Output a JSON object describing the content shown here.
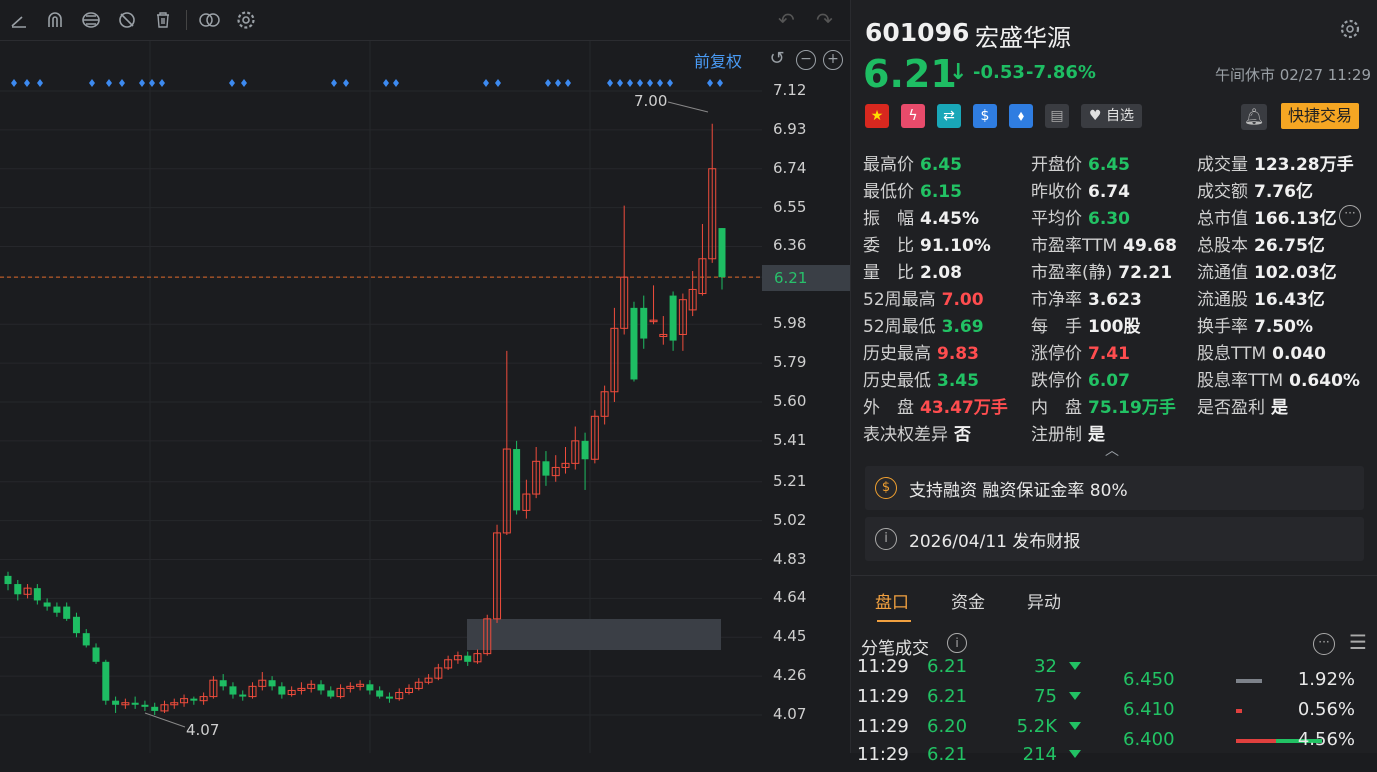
{
  "toolbar": {
    "icons": [
      "line-icon",
      "magnet-icon",
      "layers-icon",
      "hide-icon",
      "trash-icon",
      "compare-icon",
      "gear-icon"
    ],
    "fuquan_label": "前复权"
  },
  "chart_data": {
    "type": "candlestick",
    "y_ticks": [
      "7.12",
      "6.93",
      "6.74",
      "6.55",
      "6.36",
      "6.21",
      "5.98",
      "5.79",
      "5.60",
      "5.41",
      "5.21",
      "5.02",
      "4.83",
      "4.64",
      "4.45",
      "4.26",
      "4.07"
    ],
    "current_price": "6.21",
    "high_marker": "7.00",
    "low_marker": "4.07",
    "ylim": [
      4.02,
      7.16
    ],
    "candles": [
      [
        4.75,
        4.71,
        4.77,
        4.68
      ],
      [
        4.71,
        4.66,
        4.73,
        4.63
      ],
      [
        4.66,
        4.69,
        4.71,
        4.64
      ],
      [
        4.69,
        4.63,
        4.71,
        4.61
      ],
      [
        4.62,
        4.6,
        4.64,
        4.58
      ],
      [
        4.6,
        4.57,
        4.62,
        4.55
      ],
      [
        4.6,
        4.54,
        4.62,
        4.53
      ],
      [
        4.55,
        4.47,
        4.57,
        4.45
      ],
      [
        4.47,
        4.41,
        4.49,
        4.4
      ],
      [
        4.4,
        4.33,
        4.42,
        4.32
      ],
      [
        4.33,
        4.14,
        4.34,
        4.12
      ],
      [
        4.14,
        4.12,
        4.16,
        4.08
      ],
      [
        4.12,
        4.13,
        4.15,
        4.1
      ],
      [
        4.13,
        4.12,
        4.16,
        4.1
      ],
      [
        4.12,
        4.11,
        4.14,
        4.09
      ],
      [
        4.11,
        4.09,
        4.13,
        4.07
      ],
      [
        4.09,
        4.12,
        4.14,
        4.08
      ],
      [
        4.12,
        4.13,
        4.15,
        4.1
      ],
      [
        4.13,
        4.15,
        4.17,
        4.11
      ],
      [
        4.15,
        4.14,
        4.16,
        4.12
      ],
      [
        4.14,
        4.16,
        4.18,
        4.12
      ],
      [
        4.16,
        4.24,
        4.26,
        4.15
      ],
      [
        4.24,
        4.21,
        4.27,
        4.19
      ],
      [
        4.21,
        4.17,
        4.23,
        4.15
      ],
      [
        4.17,
        4.16,
        4.19,
        4.14
      ],
      [
        4.16,
        4.21,
        4.23,
        4.15
      ],
      [
        4.21,
        4.24,
        4.28,
        4.19
      ],
      [
        4.24,
        4.21,
        4.26,
        4.19
      ],
      [
        4.21,
        4.17,
        4.23,
        4.15
      ],
      [
        4.17,
        4.19,
        4.21,
        4.16
      ],
      [
        4.19,
        4.2,
        4.23,
        4.17
      ],
      [
        4.2,
        4.22,
        4.24,
        4.18
      ],
      [
        4.22,
        4.19,
        4.24,
        4.17
      ],
      [
        4.19,
        4.16,
        4.21,
        4.15
      ],
      [
        4.16,
        4.2,
        4.22,
        4.15
      ],
      [
        4.2,
        4.21,
        4.23,
        4.18
      ],
      [
        4.21,
        4.22,
        4.24,
        4.19
      ],
      [
        4.22,
        4.19,
        4.24,
        4.17
      ],
      [
        4.19,
        4.16,
        4.21,
        4.15
      ],
      [
        4.16,
        4.15,
        4.18,
        4.13
      ],
      [
        4.15,
        4.18,
        4.2,
        4.14
      ],
      [
        4.18,
        4.2,
        4.22,
        4.17
      ],
      [
        4.2,
        4.23,
        4.25,
        4.19
      ],
      [
        4.23,
        4.25,
        4.27,
        4.22
      ],
      [
        4.25,
        4.3,
        4.32,
        4.24
      ],
      [
        4.3,
        4.34,
        4.36,
        4.29
      ],
      [
        4.34,
        4.36,
        4.38,
        4.32
      ],
      [
        4.36,
        4.33,
        4.38,
        4.31
      ],
      [
        4.33,
        4.37,
        4.39,
        4.32
      ],
      [
        4.37,
        4.54,
        4.56,
        4.36
      ],
      [
        4.54,
        4.96,
        5.0,
        4.52
      ],
      [
        4.96,
        5.37,
        5.85,
        4.95
      ],
      [
        5.37,
        5.07,
        5.41,
        5.05
      ],
      [
        5.07,
        5.15,
        5.22,
        5.03
      ],
      [
        5.15,
        5.31,
        5.38,
        5.13
      ],
      [
        5.31,
        5.24,
        5.36,
        5.19
      ],
      [
        5.24,
        5.28,
        5.34,
        5.21
      ],
      [
        5.28,
        5.3,
        5.38,
        5.25
      ],
      [
        5.3,
        5.41,
        5.48,
        5.27
      ],
      [
        5.41,
        5.32,
        5.45,
        5.17
      ],
      [
        5.32,
        5.53,
        5.56,
        5.3
      ],
      [
        5.53,
        5.65,
        5.68,
        5.49
      ],
      [
        5.65,
        5.96,
        6.06,
        5.6
      ],
      [
        5.96,
        6.21,
        6.56,
        5.93
      ],
      [
        6.06,
        5.71,
        6.09,
        5.7
      ],
      [
        6.06,
        5.91,
        6.12,
        5.86
      ],
      [
        6.0,
        6.0,
        6.17,
        5.98
      ],
      [
        5.92,
        5.93,
        6.02,
        5.88
      ],
      [
        6.12,
        5.9,
        6.14,
        5.85
      ],
      [
        5.93,
        6.1,
        6.13,
        5.85
      ],
      [
        6.05,
        6.15,
        6.24,
        6.02
      ],
      [
        6.13,
        6.3,
        6.47,
        6.12
      ],
      [
        6.3,
        6.74,
        6.96,
        6.28
      ],
      [
        6.45,
        6.21,
        6.45,
        6.15
      ]
    ]
  },
  "stock": {
    "code": "601096",
    "name": "宏盛华源",
    "price": "6.21",
    "change": "-0.53",
    "change_pct": "-7.86%",
    "status_time": "午间休市 02/27 11:29",
    "watch_label": "自选",
    "quick_trade": "快捷交易"
  },
  "stats": {
    "col1": [
      {
        "label": "最高价",
        "value": "6.45",
        "color": "g"
      },
      {
        "label": "最低价",
        "value": "6.15",
        "color": "g"
      },
      {
        "label": "振　幅",
        "value": "4.45%",
        "color": "w"
      },
      {
        "label": "委　比",
        "value": "91.10%",
        "color": "w"
      },
      {
        "label": "量　比",
        "value": "2.08",
        "color": "w"
      },
      {
        "label": "52周最高",
        "value": "7.00",
        "color": "r"
      },
      {
        "label": "52周最低",
        "value": "3.69",
        "color": "g"
      },
      {
        "label": "历史最高",
        "value": "9.83",
        "color": "r"
      },
      {
        "label": "历史最低",
        "value": "3.45",
        "color": "g"
      },
      {
        "label": "外　盘",
        "value": "43.47万手",
        "color": "r"
      },
      {
        "label": "表决权差异",
        "value": "否",
        "color": "w"
      }
    ],
    "col2": [
      {
        "label": "开盘价",
        "value": "6.45",
        "color": "g"
      },
      {
        "label": "昨收价",
        "value": "6.74",
        "color": "w"
      },
      {
        "label": "平均价",
        "value": "6.30",
        "color": "g"
      },
      {
        "label": "市盈率TTM",
        "value": "49.68",
        "color": "w"
      },
      {
        "label": "市盈率(静)",
        "value": "72.21",
        "color": "w"
      },
      {
        "label": "市净率",
        "value": "3.623",
        "color": "w"
      },
      {
        "label": "每　手",
        "value": "100股",
        "color": "w"
      },
      {
        "label": "涨停价",
        "value": "7.41",
        "color": "r"
      },
      {
        "label": "跌停价",
        "value": "6.07",
        "color": "g"
      },
      {
        "label": "内　盘",
        "value": "75.19万手",
        "color": "g"
      },
      {
        "label": "注册制",
        "value": "是",
        "color": "w"
      }
    ],
    "col3": [
      {
        "label": "成交量",
        "value": "123.28万手",
        "color": "w"
      },
      {
        "label": "成交额",
        "value": "7.76亿",
        "color": "w"
      },
      {
        "label": "总市值",
        "value": "166.13亿",
        "color": "w"
      },
      {
        "label": "总股本",
        "value": "26.75亿",
        "color": "w"
      },
      {
        "label": "流通值",
        "value": "102.03亿",
        "color": "w"
      },
      {
        "label": "流通股",
        "value": "16.43亿",
        "color": "w"
      },
      {
        "label": "换手率",
        "value": "7.50%",
        "color": "w"
      },
      {
        "label": "股息TTM",
        "value": "0.040",
        "color": "w"
      },
      {
        "label": "股息率TTM",
        "value": "0.640%",
        "color": "w"
      },
      {
        "label": "是否盈利",
        "value": "是",
        "color": "w"
      }
    ]
  },
  "info": {
    "margin": "支持融资 融资保证金率 80%",
    "report": "2026/04/11  发布财报"
  },
  "tabs": [
    "盘口",
    "资金",
    "异动"
  ],
  "ticks_title": "分笔成交",
  "trades": [
    {
      "time": "11:29",
      "price": "6.21",
      "vol": "32"
    },
    {
      "time": "11:29",
      "price": "6.21",
      "vol": "75"
    },
    {
      "time": "11:29",
      "price": "6.20",
      "vol": "5.2K"
    },
    {
      "time": "11:29",
      "price": "6.21",
      "vol": "214"
    }
  ],
  "depth": [
    {
      "price": "6.450",
      "pct": "1.92%",
      "bar": 0.3,
      "bar_color": "#7d828a"
    },
    {
      "price": "6.410",
      "pct": "0.56%",
      "bar": 0.07,
      "bar_color": "#e0403e"
    },
    {
      "price": "6.400",
      "pct": "4.56%",
      "bar": 1.0,
      "bar_color": "#e0403e"
    }
  ]
}
